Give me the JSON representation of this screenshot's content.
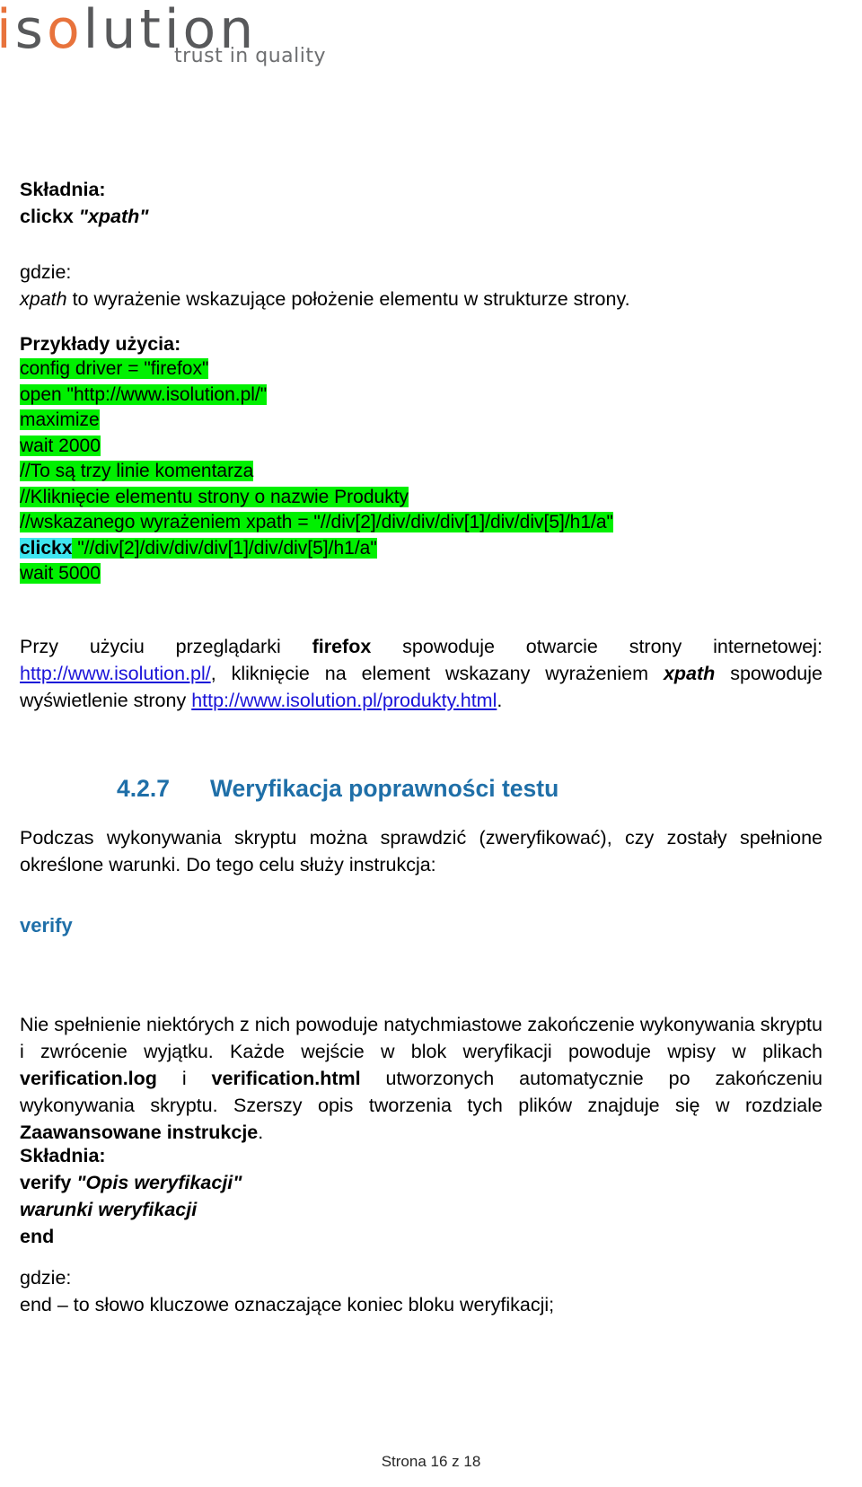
{
  "logo": {
    "letter_i": "i",
    "word_s": "s",
    "word_o": "o",
    "word_rest": "lution",
    "tagline": "trust in quality"
  },
  "section_clickx": {
    "syntax_label": "Składnia:",
    "syntax_command": "clickx",
    "syntax_arg": "\"xpath\"",
    "where_label": "gdzie:",
    "where_term": "xpath",
    "where_text": " to wyrażenie wskazujące położenie elementu w strukturze strony.",
    "examples_label": "Przykłady użycia:",
    "code_lines": [
      {
        "text": "config driver = \"firefox\"",
        "highlight": "green"
      },
      {
        "text": "open \"http://www.isolution.pl/\"",
        "highlight": "green"
      },
      {
        "text": "maximize",
        "highlight": "green"
      },
      {
        "text": "wait 2000",
        "highlight": "green"
      },
      {
        "text": "//To są trzy linie komentarza",
        "highlight": "green"
      },
      {
        "text": "//Kliknięcie elementu strony o nazwie Produkty",
        "highlight": "green"
      },
      {
        "text": "//wskazanego wyrażeniem xpath = \"//div[2]/div/div/div[1]/div/div[5]/h1/a\"",
        "highlight": "green"
      },
      {
        "keyword": "clickx",
        "keyword_highlight": "cyan",
        "text": " \"//div[2]/div/div/div[1]/div/div[5]/h1/a\"",
        "highlight": "green"
      },
      {
        "text": "wait 5000",
        "highlight": "green"
      }
    ],
    "explain_p1": "Przy użyciu przeglądarki ",
    "explain_browser": "firefox",
    "explain_p2": " spowoduje otwarcie strony internetowej: ",
    "explain_link1": "http://www.isolution.pl/",
    "explain_p3": ", kliknięcie na element wskazany wyrażeniem ",
    "explain_xpath": "xpath",
    "explain_p4": " spowoduje wyświetlenie strony ",
    "explain_link2": "http://www.isolution.pl/produkty.html",
    "explain_p5": "."
  },
  "section_verify": {
    "heading_number": "4.2.7",
    "heading_title": "Weryfikacja poprawności testu",
    "intro": "Podczas wykonywania skryptu można sprawdzić (zweryfikować), czy zostały spełnione określone warunki. Do tego celu służy instrukcja:",
    "keyword": "verify",
    "body_p1": "Nie spełnienie niektórych z nich powoduje natychmiastowe zakończenie wykonywania skryptu i zwrócenie wyjątku. Każde wejście w blok weryfikacji powoduje wpisy w plikach ",
    "body_file1": "verification.log",
    "body_p2": " i ",
    "body_file2": "verification.html",
    "body_p3": " utworzonych automatycznie po zakończeniu wykonywania skryptu. Szerszy opis tworzenia tych plików znajduje się w rozdziale ",
    "body_chapter": "Zaawansowane instrukcje",
    "body_p4": ".",
    "syntax_label": "Składnia:",
    "syntax_line1_cmd": "verify",
    "syntax_line1_arg": "\"Opis weryfikacji\"",
    "syntax_line2": "warunki weryfikacji",
    "syntax_line3": "end",
    "where_label": "gdzie:",
    "where_term": "end",
    "where_text": " – to słowo kluczowe oznaczające koniec bloku weryfikacji;"
  },
  "footer": {
    "page_text": "Strona 16 z 18"
  },
  "colors": {
    "heading_blue": "#1f6fa8",
    "link_blue": "#1a13d8",
    "highlight_green": "#00f000",
    "highlight_cyan": "#3ee6f0",
    "logo_orange": "#e8733c",
    "logo_grey": "#58595b"
  }
}
